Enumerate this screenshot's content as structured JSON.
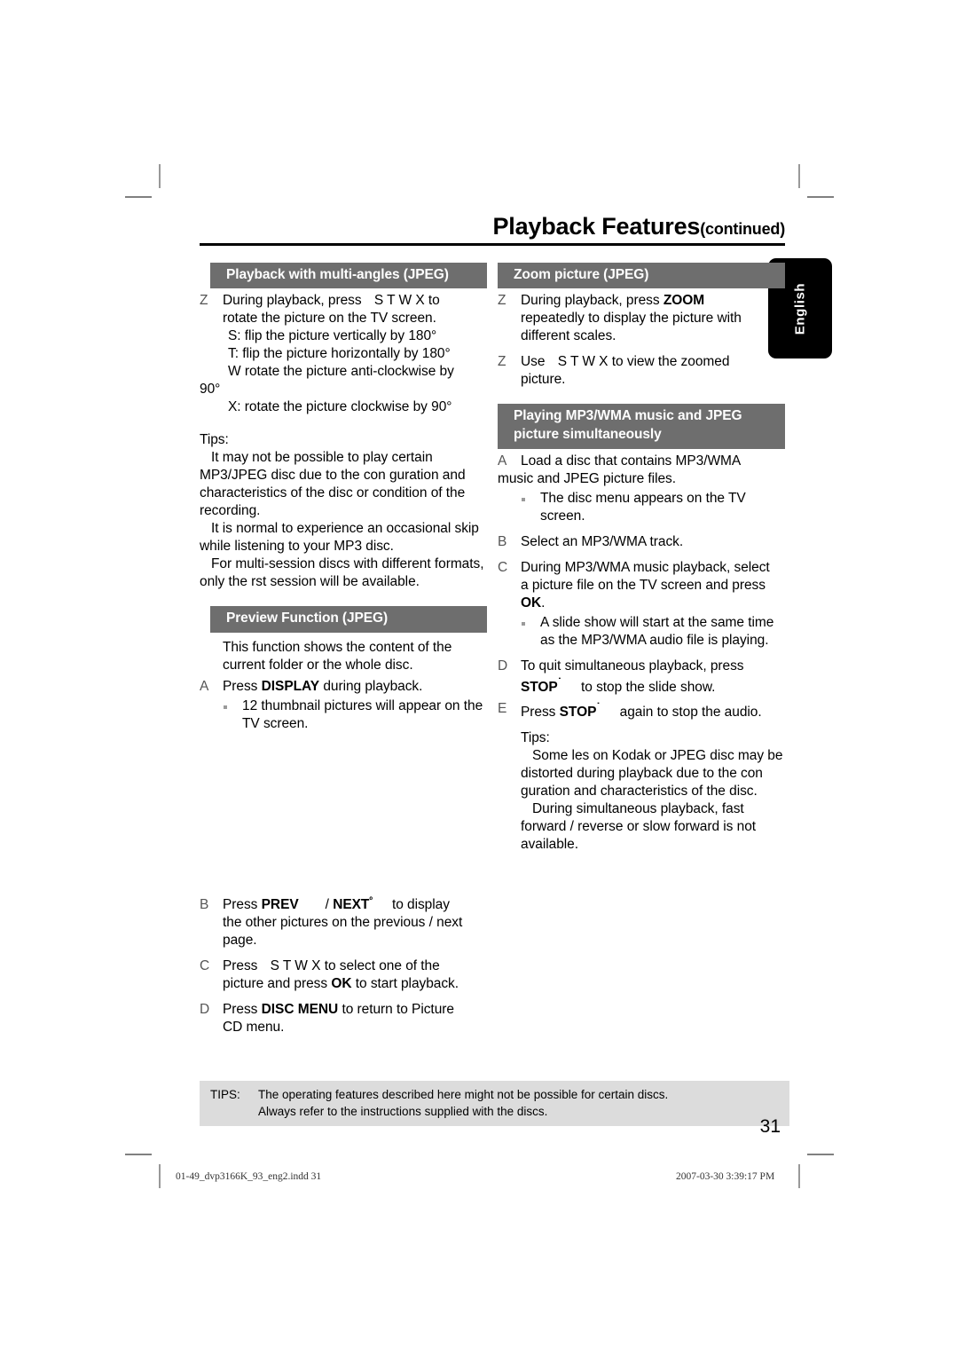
{
  "header": {
    "title": "Playback Features",
    "continued": "(continued)"
  },
  "language_tab": {
    "label": "English"
  },
  "left_column": {
    "section_multiangle": {
      "heading": "Playback with multi-angles (JPEG)",
      "item_z": {
        "marker": "Z",
        "line1_a": "During playback, press",
        "keys": "S  T  W X",
        "line1_b": "to",
        "line2": "rotate the picture on the TV screen."
      },
      "key_lines": [
        "S: flip the picture vertically by 180°",
        "T: flip the picture horizontally by 180°",
        "W rotate the picture anti-clockwise by",
        "90°",
        "X: rotate the picture clockwise by 90°"
      ],
      "tips_label": "Tips:",
      "tips": [
        "It may not be possible to play certain MP3/JPEG disc due to the con guration and characteristics of the disc or condition of the recording.",
        "It is normal to experience an occasional  skip  while listening to your MP3 disc.",
        "For multi-session discs with different formats, only the  rst session will be available."
      ]
    },
    "section_preview": {
      "heading": "Preview Function (JPEG)",
      "intro": "This function shows the content of the current folder or the whole disc.",
      "item_a": {
        "marker": "A",
        "pre": "Press",
        "bold": "DISPLAY",
        "post": "during playback.",
        "note": "12 thumbnail pictures will appear on the TV screen."
      },
      "item_b": {
        "marker": "B",
        "pre": "Press",
        "bold1": "PREV",
        "mid": "/",
        "bold2": "NEXT",
        "glyph": "º",
        "post": "to display",
        "line2": "the other pictures on the previous / next",
        "line3": "page."
      },
      "item_c": {
        "marker": "C",
        "pre": "Press",
        "keys": "S  T  W X",
        "post": "to select one of the",
        "line2_pre": "picture and press",
        "line2_bold": "OK",
        "line2_post": "to start playback."
      },
      "item_d": {
        "marker": "D",
        "pre": "Press",
        "bold": "DISC MENU",
        "post": "to return to Picture",
        "line2": "CD menu."
      }
    }
  },
  "right_column": {
    "section_zoom": {
      "heading": "Zoom picture (JPEG)",
      "item_z1": {
        "marker": "Z",
        "pre": "During playback, press",
        "bold": "ZOOM",
        "line2": "repeatedly to display the picture with",
        "line3": "different scales."
      },
      "item_z2": {
        "marker": "Z",
        "pre": "Use",
        "keys": "S  T  W X",
        "post": "to view the zoomed",
        "line2": "picture."
      }
    },
    "section_simultaneous": {
      "heading_line1": "Playing MP3/WMA music and JPEG",
      "heading_line2": "picture simultaneously",
      "item_a": {
        "marker": "A",
        "line1": "Load a disc that contains MP3/WMA",
        "line2": "music and JPEG picture files.",
        "note": "The disc menu appears on the TV screen."
      },
      "item_b": {
        "marker": "B",
        "line1": "Select an MP3/WMA track."
      },
      "item_c": {
        "marker": "C",
        "line1": "During MP3/WMA music playback, select",
        "line2": "a picture file on the TV screen and press",
        "bold": "OK",
        "period": ".",
        "note": "A slide show will start at the same time as the MP3/WMA audio file is playing."
      },
      "item_d": {
        "marker": "D",
        "line1": "To quit simultaneous playback, press",
        "bold": "STOP",
        "glyph": "˙",
        "post": "to stop the slide show."
      },
      "item_e": {
        "marker": "E",
        "pre": "Press",
        "bold": "STOP",
        "glyph": "˙",
        "post": "again to stop the audio."
      },
      "tips_label": "Tips:",
      "tips": [
        "Some  les on Kodak or JPEG disc may be distorted during playback due to the con guration and characteristics of the disc.",
        "During simultaneous playback, fast forward / reverse or slow forward is not available."
      ]
    }
  },
  "footer_tips": {
    "label": "TIPS:",
    "line1": "The operating features described here might not be possible for certain discs.",
    "line2": "Always refer to the instructions supplied with the discs."
  },
  "page_number": "31",
  "production_slug": {
    "file": "01-49_dvp3166K_93_eng2.indd   31",
    "timestamp": "2007-03-30   3:39:17 PM"
  },
  "colors": {
    "heading_bar": "#6e6e6e",
    "tips_panel": "#dcdcdc",
    "lang_tab": "#000000"
  }
}
